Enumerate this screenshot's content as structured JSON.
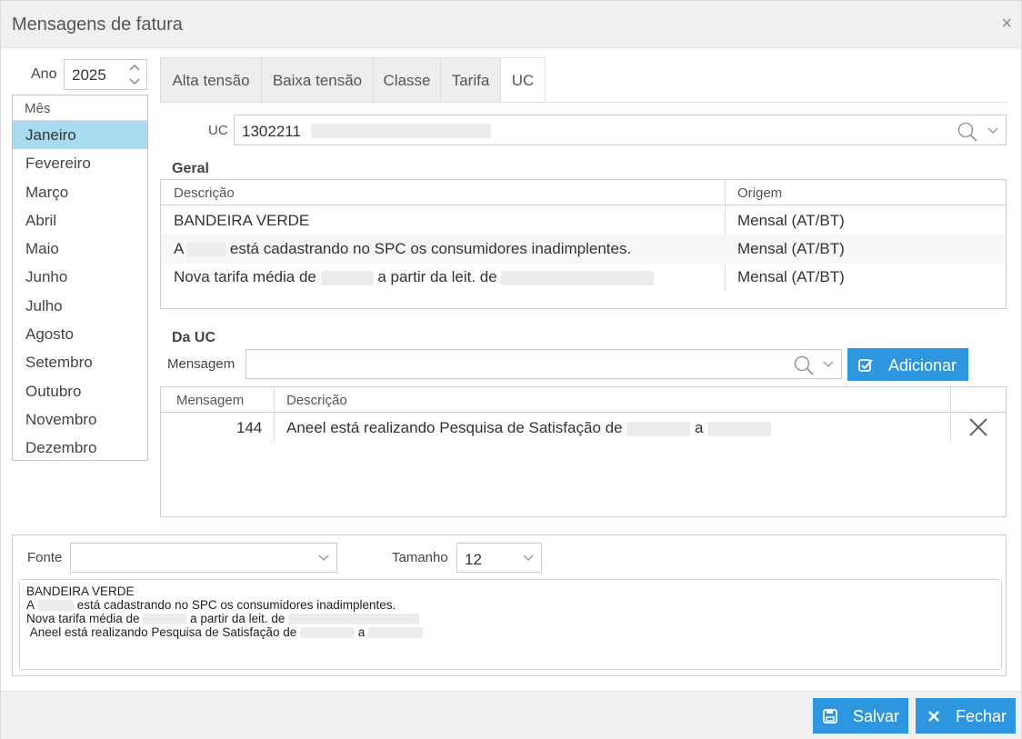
{
  "dialog": {
    "title": "Mensagens de fatura",
    "close_symbol": "×"
  },
  "ano": {
    "label": "Ano",
    "value": "2025"
  },
  "meses": {
    "header": "Mês",
    "items": [
      "Janeiro",
      "Fevereiro",
      "Março",
      "Abril",
      "Maio",
      "Junho",
      "Julho",
      "Agosto",
      "Setembro",
      "Outubro",
      "Novembro",
      "Dezembro"
    ],
    "selected": "Janeiro"
  },
  "tabs": [
    {
      "label": "Alta tensão",
      "active": false
    },
    {
      "label": "Baixa tensão",
      "active": false
    },
    {
      "label": "Classe",
      "active": false
    },
    {
      "label": "Tarifa",
      "active": false
    },
    {
      "label": "UC",
      "active": true
    }
  ],
  "uc": {
    "label": "UC",
    "value": "1302211"
  },
  "geral": {
    "title": "Geral",
    "columns": [
      "Descrição",
      "Origem"
    ],
    "rows": [
      {
        "descricao": "BANDEIRA VERDE",
        "origem": "Mensal (AT/BT)"
      },
      {
        "descricao_a": "A",
        "descricao_b": "está cadastrando no SPC os consumidores inadimplentes.",
        "origem": "Mensal (AT/BT)"
      },
      {
        "descricao_a": "Nova tarifa média de",
        "descricao_b": "a partir da leit. de",
        "origem": "Mensal (AT/BT)"
      }
    ]
  },
  "da_uc": {
    "title": "Da UC",
    "mensagem_label": "Mensagem",
    "mensagem_value": "",
    "add_label": "Adicionar",
    "columns": [
      "Mensagem",
      "Descrição"
    ],
    "rows": [
      {
        "mensagem": "144",
        "descricao_a": "Aneel está realizando Pesquisa de Satisfação de",
        "descricao_b": "a"
      }
    ]
  },
  "format": {
    "fonte_label": "Fonte",
    "fonte_value": "",
    "tamanho_label": "Tamanho",
    "tamanho_value": "12"
  },
  "preview": {
    "line1": "BANDEIRA VERDE",
    "line2_a": "A",
    "line2_b": "está cadastrando no SPC os consumidores inadimplentes.",
    "line3_a": "Nova tarifa média de",
    "line3_b": "a partir da leit. de",
    "line4_a": "Aneel está realizando Pesquisa de Satisfação de",
    "line4_b": "a"
  },
  "footer": {
    "save_label": "Salvar",
    "close_label": "Fechar"
  },
  "colors": {
    "accent": "#2e96de",
    "selected_row": "#a8dbf0"
  }
}
